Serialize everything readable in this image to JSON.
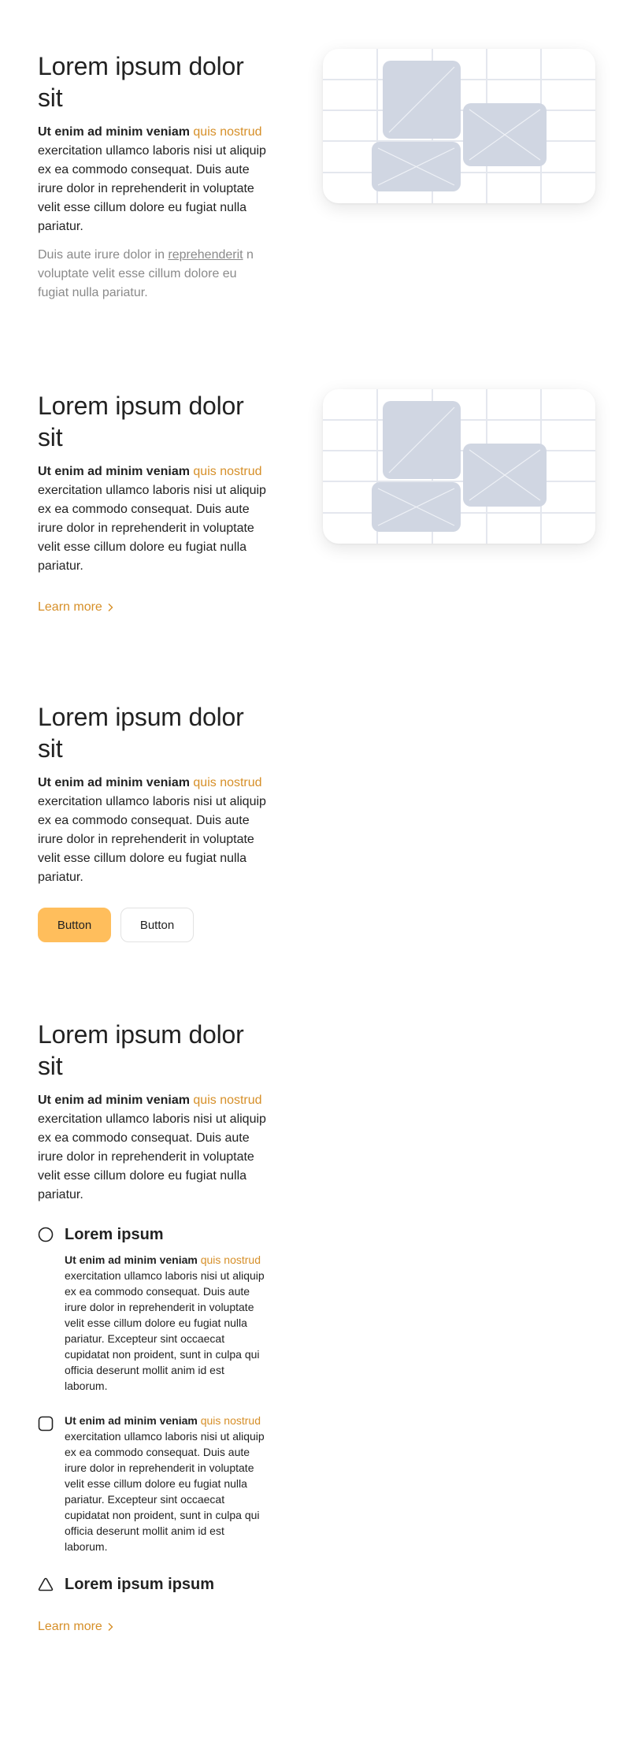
{
  "colors": {
    "accent": "#d68f28",
    "primary_button": "#ffbe5c",
    "placeholder_tile": "#d0d6e2",
    "grid_line": "#e4e7ee"
  },
  "sections": [
    {
      "title": "Lorem ipsum dolor sit",
      "lead_prefix": "Ut enim ad minim veniam ",
      "lead_accent": "quis nostrud",
      "lead_suffix": " exercitation ullamco laboris nisi ut aliquip ex ea commodo consequat. Duis aute irure dolor in reprehenderit in voluptate velit esse cillum dolore eu fugiat nulla pariatur.",
      "muted_prefix": "Duis aute irure dolor in ",
      "muted_link": "reprehenderit",
      "muted_suffix": " n voluptate velit esse cillum dolore eu fugiat nulla pariatur.",
      "image_icon": "image-placeholder-icon"
    },
    {
      "title": "Lorem ipsum dolor sit",
      "lead_prefix": "Ut enim ad minim veniam ",
      "lead_accent": "quis nostrud",
      "lead_suffix": " exercitation ullamco laboris nisi ut aliquip ex ea commodo consequat. Duis aute irure dolor in reprehenderit in voluptate velit esse cillum dolore eu fugiat nulla pariatur.",
      "learn_more": "Learn more",
      "image_icon": "image-placeholder-icon"
    },
    {
      "title": "Lorem ipsum dolor sit",
      "lead_prefix": "Ut enim ad minim veniam ",
      "lead_accent": "quis nostrud",
      "lead_suffix": " exercitation ullamco laboris nisi ut aliquip ex ea commodo consequat. Duis aute irure dolor in reprehenderit in voluptate velit esse cillum dolore eu fugiat nulla pariatur.",
      "primary_button": "Button",
      "secondary_button": "Button"
    },
    {
      "title": "Lorem ipsum dolor sit",
      "lead_prefix": "Ut enim ad minim veniam ",
      "lead_accent": "quis nostrud",
      "lead_suffix": " exercitation ullamco laboris nisi ut aliquip ex ea commodo consequat. Duis aute irure dolor in reprehenderit in voluptate velit esse cillum dolore eu fugiat nulla pariatur.",
      "features": [
        {
          "icon": "circle-icon",
          "title": "Lorem ipsum",
          "text_prefix": "Ut enim ad minim veniam ",
          "text_accent": "quis nostrud",
          "text_suffix": " exercitation ullamco laboris nisi ut aliquip ex ea commodo consequat. Duis aute irure dolor in reprehenderit in voluptate velit esse cillum dolore eu fugiat nulla pariatur. Excepteur sint occaecat cupidatat non proident, sunt in culpa qui officia deserunt mollit anim id est laborum."
        },
        {
          "icon": "square-icon",
          "text_prefix": "Ut enim ad minim veniam ",
          "text_accent": "quis nostrud",
          "text_suffix": " exercitation ullamco laboris nisi ut aliquip ex ea commodo consequat. Duis aute irure dolor in reprehenderit in voluptate velit esse cillum dolore eu fugiat nulla pariatur. Excepteur sint occaecat cupidatat non proident, sunt in culpa qui officia deserunt mollit anim id est laborum."
        },
        {
          "icon": "triangle-icon",
          "title": "Lorem ipsum ipsum"
        }
      ],
      "learn_more": "Learn more"
    }
  ]
}
